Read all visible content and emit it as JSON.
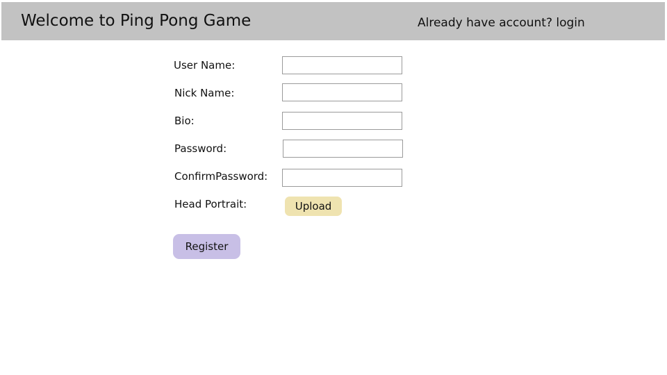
{
  "header": {
    "title": "Welcome to Ping Pong Game",
    "login_link": "Already have account? login"
  },
  "form": {
    "fields": [
      {
        "label": "User Name:",
        "value": "",
        "placeholder": ""
      },
      {
        "label": "Nick Name:",
        "value": "",
        "placeholder": ""
      },
      {
        "label": "Bio:",
        "value": "",
        "placeholder": ""
      },
      {
        "label": "Password:",
        "value": "",
        "placeholder": ""
      },
      {
        "label": "ConfirmPassword:",
        "value": "",
        "placeholder": ""
      }
    ],
    "portrait_label": "Head Portrait:",
    "upload_label": "Upload",
    "register_label": "Register"
  },
  "colors": {
    "header_bg": "#c2c2c2",
    "upload_bg": "#efe3b0",
    "register_bg": "#c8bfe6"
  }
}
